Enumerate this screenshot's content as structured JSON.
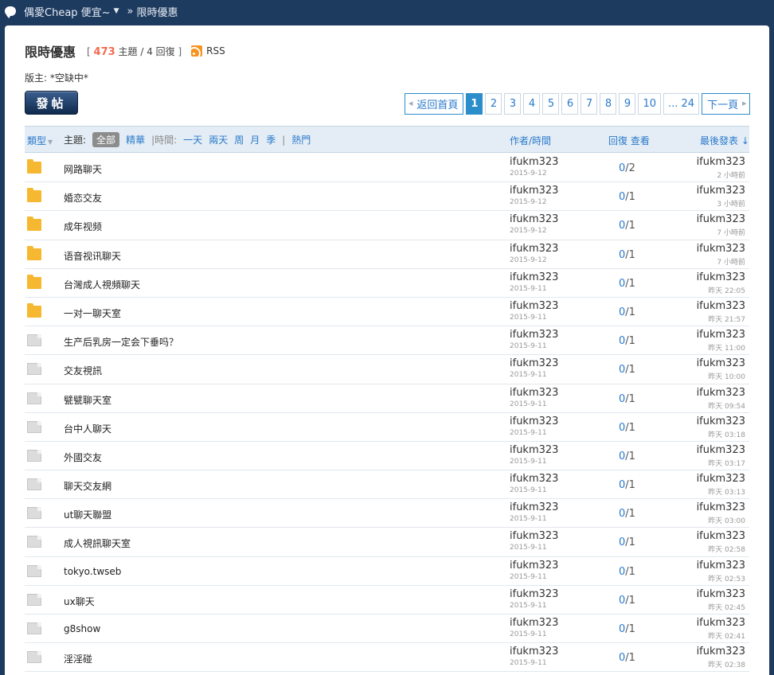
{
  "topbar": {
    "site": "偶愛Cheap 便宜~",
    "sep": "»",
    "current": "限時優惠"
  },
  "forum": {
    "title": "限時優惠",
    "open_bracket": "[",
    "close_bracket": "]",
    "topic_count": "473",
    "topic_label": "主題 /",
    "reply_count_label": "4 回復",
    "rss_label": "RSS",
    "moderator": "版主: *空缺中*"
  },
  "post_button": {
    "label": "發帖"
  },
  "pagination": {
    "back": "返回首頁",
    "pages": [
      "1",
      "2",
      "3",
      "4",
      "5",
      "6",
      "7",
      "8",
      "9",
      "10"
    ],
    "ellipsis_last": "... 24",
    "next": "下一頁",
    "current": "1"
  },
  "table_header": {
    "type": "類型",
    "subject_label": "主題:",
    "filter_all": "全部",
    "filter_digest": "精華",
    "time_label": "|時間:",
    "time_options": [
      "一天",
      "兩天",
      "周",
      "月",
      "季"
    ],
    "hot_sep": "|",
    "hot": "熱門",
    "author_time": "作者/時間",
    "reply_view": "回復 查看",
    "last_post": "最後發表 ↓"
  },
  "threads": [
    {
      "icon": "folder",
      "subject": "网路聊天",
      "author": "ifukm323",
      "date": "2015-9-12",
      "replies": "0",
      "views": "2",
      "last_author": "ifukm323",
      "last_time": "2 小時前"
    },
    {
      "icon": "folder",
      "subject": "婚恋交友",
      "author": "ifukm323",
      "date": "2015-9-12",
      "replies": "0",
      "views": "1",
      "last_author": "ifukm323",
      "last_time": "3 小時前"
    },
    {
      "icon": "folder",
      "subject": "成年视频",
      "author": "ifukm323",
      "date": "2015-9-12",
      "replies": "0",
      "views": "1",
      "last_author": "ifukm323",
      "last_time": "7 小時前"
    },
    {
      "icon": "folder",
      "subject": "语音视讯聊天",
      "author": "ifukm323",
      "date": "2015-9-12",
      "replies": "0",
      "views": "1",
      "last_author": "ifukm323",
      "last_time": "7 小時前"
    },
    {
      "icon": "folder",
      "subject": "台灣成人視頻聊天",
      "author": "ifukm323",
      "date": "2015-9-11",
      "replies": "0",
      "views": "1",
      "last_author": "ifukm323",
      "last_time": "昨天 22:05"
    },
    {
      "icon": "folder",
      "subject": "一对一聊天室",
      "author": "ifukm323",
      "date": "2015-9-11",
      "replies": "0",
      "views": "1",
      "last_author": "ifukm323",
      "last_time": "昨天 21:57"
    },
    {
      "icon": "doc",
      "subject": "生产后乳房一定会下垂吗？",
      "author": "ifukm323",
      "date": "2015-9-11",
      "replies": "0",
      "views": "1",
      "last_author": "ifukm323",
      "last_time": "昨天 11:00"
    },
    {
      "icon": "doc",
      "subject": "交友視訊",
      "author": "ifukm323",
      "date": "2015-9-11",
      "replies": "0",
      "views": "1",
      "last_author": "ifukm323",
      "last_time": "昨天 10:00"
    },
    {
      "icon": "doc",
      "subject": "甓甓聊天室",
      "author": "ifukm323",
      "date": "2015-9-11",
      "replies": "0",
      "views": "1",
      "last_author": "ifukm323",
      "last_time": "昨天 09:54"
    },
    {
      "icon": "doc",
      "subject": "台中人聊天",
      "author": "ifukm323",
      "date": "2015-9-11",
      "replies": "0",
      "views": "1",
      "last_author": "ifukm323",
      "last_time": "昨天 03:18"
    },
    {
      "icon": "doc",
      "subject": "外國交友",
      "author": "ifukm323",
      "date": "2015-9-11",
      "replies": "0",
      "views": "1",
      "last_author": "ifukm323",
      "last_time": "昨天 03:17"
    },
    {
      "icon": "doc",
      "subject": "聊天交友網",
      "author": "ifukm323",
      "date": "2015-9-11",
      "replies": "0",
      "views": "1",
      "last_author": "ifukm323",
      "last_time": "昨天 03:13"
    },
    {
      "icon": "doc",
      "subject": "ut聊天聯盟",
      "author": "ifukm323",
      "date": "2015-9-11",
      "replies": "0",
      "views": "1",
      "last_author": "ifukm323",
      "last_time": "昨天 03:00"
    },
    {
      "icon": "doc",
      "subject": "成人視訊聊天室",
      "author": "ifukm323",
      "date": "2015-9-11",
      "replies": "0",
      "views": "1",
      "last_author": "ifukm323",
      "last_time": "昨天 02:58"
    },
    {
      "icon": "doc",
      "subject": "tokyo.twseb",
      "author": "ifukm323",
      "date": "2015-9-11",
      "replies": "0",
      "views": "1",
      "last_author": "ifukm323",
      "last_time": "昨天 02:53"
    },
    {
      "icon": "doc",
      "subject": "ux聊天",
      "author": "ifukm323",
      "date": "2015-9-11",
      "replies": "0",
      "views": "1",
      "last_author": "ifukm323",
      "last_time": "昨天 02:45"
    },
    {
      "icon": "doc",
      "subject": "g8show",
      "author": "ifukm323",
      "date": "2015-9-11",
      "replies": "0",
      "views": "1",
      "last_author": "ifukm323",
      "last_time": "昨天 02:41"
    },
    {
      "icon": "doc",
      "subject": "淫淫碰",
      "author": "ifukm323",
      "date": "2015-9-11",
      "replies": "0",
      "views": "1",
      "last_author": "ifukm323",
      "last_time": "昨天 02:38"
    }
  ]
}
